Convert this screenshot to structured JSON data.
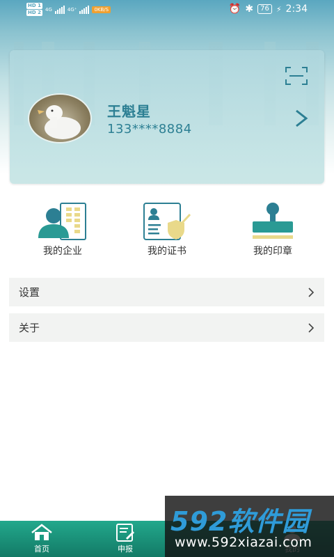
{
  "status_bar": {
    "sim1": "HD 1",
    "sim2": "HD 2",
    "signal1": "4G",
    "signal2": "4G⁺",
    "net_speed": "0KB/S",
    "battery": "76",
    "time": "2:34"
  },
  "profile": {
    "name": "王魁星",
    "phone": "133****8884"
  },
  "quick_actions": [
    {
      "label": "我的企业"
    },
    {
      "label": "我的证书"
    },
    {
      "label": "我的印章"
    }
  ],
  "menu": [
    {
      "label": "设置"
    },
    {
      "label": "关于"
    }
  ],
  "tabs": [
    {
      "label": "首页"
    },
    {
      "label": "申报"
    },
    {
      "label": "我的"
    }
  ],
  "watermark": {
    "brand": "592软件园",
    "url": "www.592xiazai.com"
  },
  "colors": {
    "accent": "#2c7f93",
    "tab_bar": "#1a9a80",
    "list_bg": "#f2f3f2"
  }
}
